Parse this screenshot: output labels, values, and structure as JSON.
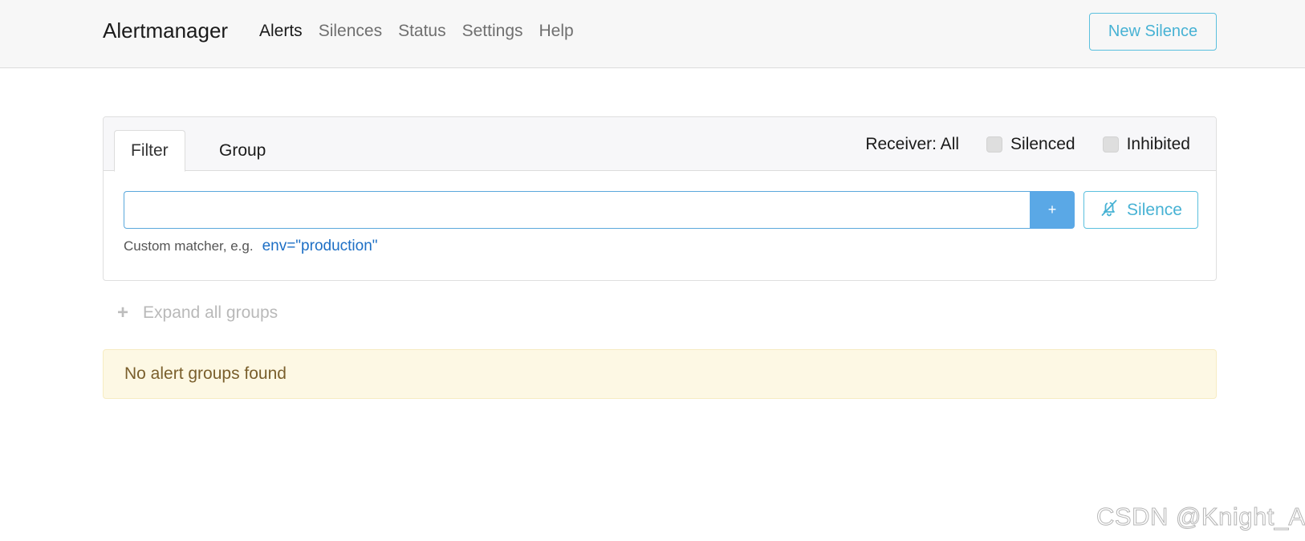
{
  "navbar": {
    "brand": "Alertmanager",
    "links": [
      {
        "label": "Alerts",
        "active": true
      },
      {
        "label": "Silences",
        "active": false
      },
      {
        "label": "Status",
        "active": false
      },
      {
        "label": "Settings",
        "active": false
      },
      {
        "label": "Help",
        "active": false
      }
    ],
    "new_silence_label": "New Silence"
  },
  "filter_card": {
    "tabs": [
      {
        "label": "Filter",
        "active": true
      },
      {
        "label": "Group",
        "active": false
      }
    ],
    "receiver_label": "Receiver: All",
    "silenced": {
      "label": "Silenced",
      "checked": false
    },
    "inhibited": {
      "label": "Inhibited",
      "checked": false
    },
    "input_value": "",
    "add_label": "+",
    "silence_label": "Silence",
    "help_text": "Custom matcher, e.g.",
    "help_example": "env=\"production\""
  },
  "expand_all_label": "Expand all groups",
  "alert_message": "No alert groups found",
  "watermark": "CSDN @Knight_AL",
  "colors": {
    "accent_info": "#5bc0de",
    "primary_button": "#5aa8e6",
    "warning_bg": "#fdf8e4",
    "warning_text": "#7a5f2c",
    "link": "#1d6fc5"
  }
}
